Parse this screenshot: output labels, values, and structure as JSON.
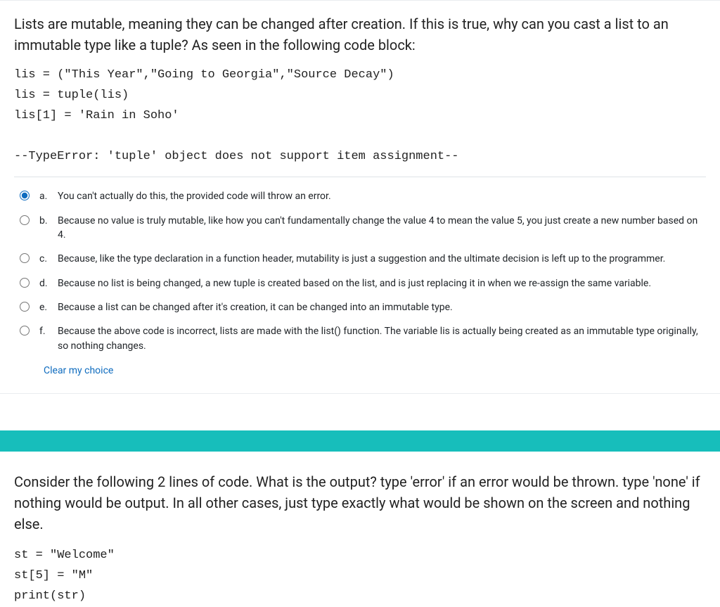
{
  "q1": {
    "prompt": "Lists are mutable, meaning they can be changed after creation. If this is true, why can you cast a list to an immutable type like a tuple? As seen in  the following code block:",
    "code": "lis = (\"This Year\",\"Going to Georgia\",\"Source Decay\")\nlis = tuple(lis)\nlis[1] = 'Rain in Soho'\n\n--TypeError: 'tuple' object does not support item assignment--",
    "options": [
      {
        "letter": "a.",
        "text": "You can't actually do this, the provided code will throw an error.",
        "selected": true
      },
      {
        "letter": "b.",
        "text": "Because no value is truly mutable, like how you can't fundamentally change the value 4 to mean the value 5, you just create a new number based on 4.",
        "selected": false
      },
      {
        "letter": "c.",
        "text": "Because, like the type declaration in a function header, mutability is just a suggestion and the ultimate decision is left up to the programmer.",
        "selected": false
      },
      {
        "letter": "d.",
        "text": "Because no list is being changed, a new tuple is created based on the list, and is just replacing it in when we re-assign the same variable.",
        "selected": false
      },
      {
        "letter": "e.",
        "text": "Because a list can be changed after it's creation, it can be changed into an immutable type.",
        "selected": false
      },
      {
        "letter": "f.",
        "text": "Because the above code is incorrect, lists are made with the list() function. The variable lis is actually being created as an immutable type originally, so nothing changes.",
        "selected": false
      }
    ],
    "clear_label": "Clear my choice"
  },
  "q2": {
    "prompt": "Consider the following 2 lines of code. What is the output? type 'error' if an error would be thrown. type 'none' if nothing would be output. In all other cases, just type exactly what would be shown on the screen and nothing else.",
    "code": "st = \"Welcome\"\nst[5] = \"M\"\nprint(str)"
  }
}
